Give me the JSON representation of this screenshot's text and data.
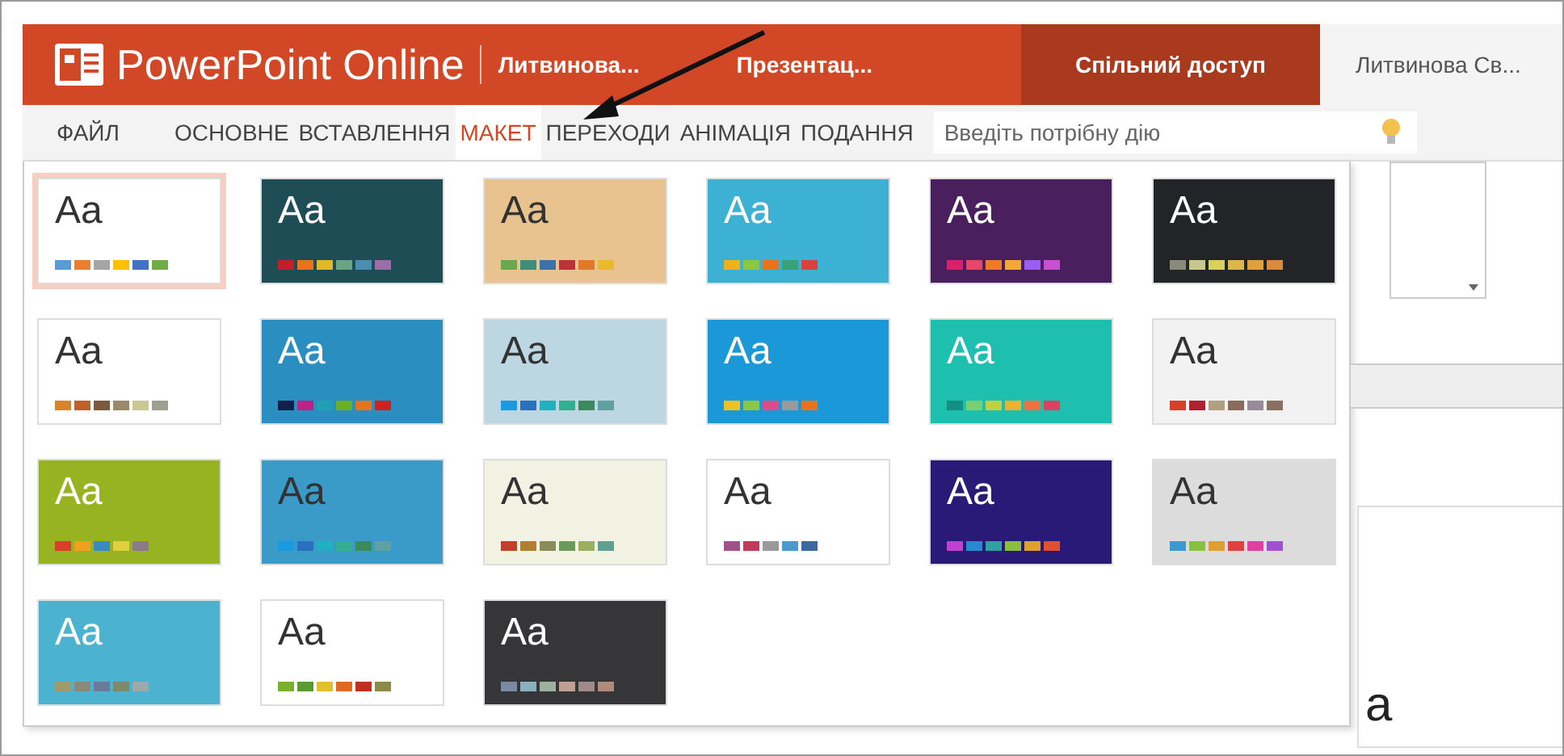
{
  "title_bar": {
    "app_name": "PowerPoint Online",
    "owner": "Литвинова...",
    "document": "Презентац...",
    "share_button": "Спільний доступ",
    "user": "Литвинова Св..."
  },
  "tabs": [
    {
      "label": "ФАЙЛ",
      "selected": false
    },
    {
      "label": "ОСНОВНЕ",
      "selected": false
    },
    {
      "label": "ВСТАВЛЕННЯ",
      "selected": false
    },
    {
      "label": "МАКЕТ",
      "selected": true
    },
    {
      "label": "ПЕРЕХОДИ",
      "selected": false
    },
    {
      "label": "АНІМАЦІЯ",
      "selected": false
    },
    {
      "label": "ПОДАННЯ",
      "selected": false
    }
  ],
  "tell_me": {
    "placeholder": "Введіть потрібну дію"
  },
  "themes": [
    {
      "sample": "Aa",
      "kind": "light",
      "color": "#ffffff",
      "selected": true,
      "swatches": [
        {
          "color": "#5b9bd5"
        },
        {
          "color": "#ed7d31"
        },
        {
          "color": "#a5a5a5"
        },
        {
          "color": "#ffc000"
        },
        {
          "color": "#4472c4"
        },
        {
          "color": "#70ad47"
        }
      ]
    },
    {
      "sample": "Aa",
      "kind": "dark",
      "color": "#1e4d56",
      "selected": false,
      "swatches": [
        {
          "color": "#c0202a"
        },
        {
          "color": "#e8731a"
        },
        {
          "color": "#e0b82a"
        },
        {
          "color": "#6aa583"
        },
        {
          "color": "#4b8db0"
        },
        {
          "color": "#9b6eaa"
        }
      ]
    },
    {
      "sample": "Aa",
      "kind": "light",
      "color": "#e8c38f",
      "selected": false,
      "swatches": [
        {
          "color": "#6aa84f"
        },
        {
          "color": "#3c8d7a"
        },
        {
          "color": "#3d6fa8"
        },
        {
          "color": "#b8333a"
        },
        {
          "color": "#e2782a"
        },
        {
          "color": "#e9b92e"
        }
      ]
    },
    {
      "sample": "Aa",
      "kind": "dark",
      "color": "#3cb1d4",
      "selected": false,
      "swatches": [
        {
          "color": "#f0b21a"
        },
        {
          "color": "#8dc63f"
        },
        {
          "color": "#e8731a"
        },
        {
          "color": "#3aa07a"
        },
        {
          "color": "#d9413a"
        }
      ]
    },
    {
      "sample": "Aa",
      "kind": "dark",
      "color": "#4a1f5e",
      "selected": false,
      "swatches": [
        {
          "color": "#d9206a"
        },
        {
          "color": "#e8456a"
        },
        {
          "color": "#ef7a2a"
        },
        {
          "color": "#f2a93a"
        },
        {
          "color": "#9a5ef0"
        },
        {
          "color": "#c84fd0"
        }
      ]
    },
    {
      "sample": "Aa",
      "kind": "dark",
      "color": "#222428",
      "selected": false,
      "swatches": [
        {
          "color": "#8a8a7a"
        },
        {
          "color": "#c7c78a"
        },
        {
          "color": "#d9d25a"
        },
        {
          "color": "#d9b84a"
        },
        {
          "color": "#e0a03a"
        },
        {
          "color": "#d98a3a"
        }
      ]
    },
    {
      "sample": "Aa",
      "kind": "light",
      "color": "#ffffff",
      "selected": false,
      "swatches": [
        {
          "color": "#d9822a"
        },
        {
          "color": "#c0602a"
        },
        {
          "color": "#7a5a3a"
        },
        {
          "color": "#9a8a6a"
        },
        {
          "color": "#c8c890"
        },
        {
          "color": "#a0a090"
        }
      ]
    },
    {
      "sample": "Aa",
      "kind": "dark",
      "color": "#2a8fc0",
      "selected": false,
      "swatches": [
        {
          "color": "#10204a"
        },
        {
          "color": "#c0208a"
        },
        {
          "color": "#20a0b0"
        },
        {
          "color": "#6ab020"
        },
        {
          "color": "#e8731a"
        },
        {
          "color": "#d02020"
        }
      ]
    },
    {
      "sample": "Aa",
      "kind": "light",
      "color": "#bcd6e2",
      "selected": false,
      "swatches": [
        {
          "color": "#1a9ae0"
        },
        {
          "color": "#2a70c0"
        },
        {
          "color": "#20b0c0"
        },
        {
          "color": "#30b090"
        },
        {
          "color": "#3a8a5a"
        },
        {
          "color": "#60a0a0"
        }
      ]
    },
    {
      "sample": "Aa",
      "kind": "dark",
      "color": "#1a98d8",
      "selected": false,
      "swatches": [
        {
          "color": "#f0c020"
        },
        {
          "color": "#8dc63f"
        },
        {
          "color": "#e04a8a"
        },
        {
          "color": "#9a9a9a"
        },
        {
          "color": "#e8731a"
        }
      ]
    },
    {
      "sample": "Aa",
      "kind": "dark",
      "color": "#1fbfb0",
      "selected": false,
      "swatches": [
        {
          "color": "#138f84"
        },
        {
          "color": "#7ad070"
        },
        {
          "color": "#c0d040"
        },
        {
          "color": "#f0b030"
        },
        {
          "color": "#f07040"
        },
        {
          "color": "#e04060"
        }
      ]
    },
    {
      "sample": "Aa",
      "kind": "light",
      "color": "#f2f2f2",
      "selected": false,
      "swatches": [
        {
          "color": "#d9402a"
        },
        {
          "color": "#b02030"
        },
        {
          "color": "#b0a080"
        },
        {
          "color": "#8a6a5a"
        },
        {
          "color": "#9a8a9a"
        },
        {
          "color": "#8a7060"
        }
      ]
    },
    {
      "sample": "Aa",
      "kind": "dark",
      "color": "#98b322",
      "selected": false,
      "swatches": [
        {
          "color": "#d9402a"
        },
        {
          "color": "#f0a020"
        },
        {
          "color": "#3a8ac0"
        },
        {
          "color": "#e0d040"
        },
        {
          "color": "#8a7a8a"
        }
      ]
    },
    {
      "sample": "Aa",
      "kind": "light",
      "color": "#3a9ac8",
      "selected": false,
      "swatches": [
        {
          "color": "#1a9ae0"
        },
        {
          "color": "#2a70c0"
        },
        {
          "color": "#20b0c0"
        },
        {
          "color": "#30b090"
        },
        {
          "color": "#3a8a5a"
        },
        {
          "color": "#60a0a0"
        }
      ]
    },
    {
      "sample": "Aa",
      "kind": "light",
      "color": "#f1f2e2",
      "selected": false,
      "swatches": [
        {
          "color": "#c0402a"
        },
        {
          "color": "#b08030"
        },
        {
          "color": "#8a8a5a"
        },
        {
          "color": "#6a9a5a"
        },
        {
          "color": "#9ab060"
        },
        {
          "color": "#60a090"
        }
      ]
    },
    {
      "sample": "Aa",
      "kind": "light",
      "color": "#ffffff",
      "selected": false,
      "swatches": [
        {
          "color": "#a0508a"
        },
        {
          "color": "#c03a5a"
        },
        {
          "color": "#9a9a9a"
        },
        {
          "color": "#4a9ad0"
        },
        {
          "color": "#3a6aa0"
        }
      ]
    },
    {
      "sample": "Aa",
      "kind": "dark",
      "color": "#2a1a78",
      "selected": false,
      "swatches": [
        {
          "color": "#c040d0"
        },
        {
          "color": "#2a8ad0"
        },
        {
          "color": "#30a0a0"
        },
        {
          "color": "#8ac040"
        },
        {
          "color": "#e0a030"
        },
        {
          "color": "#e05030"
        }
      ]
    },
    {
      "sample": "Aa",
      "kind": "light",
      "color": "#dcdcdc",
      "selected": false,
      "swatches": [
        {
          "color": "#3a9ad0"
        },
        {
          "color": "#8ac040"
        },
        {
          "color": "#e0a030"
        },
        {
          "color": "#e04040"
        },
        {
          "color": "#e040a0"
        },
        {
          "color": "#a050d0"
        }
      ]
    },
    {
      "sample": "Aa",
      "kind": "dark",
      "color": "#4bb3cf",
      "selected": false,
      "swatches": [
        {
          "color": "#a09a6a"
        },
        {
          "color": "#8a8a7a"
        },
        {
          "color": "#6a7a9a"
        },
        {
          "color": "#7a8a6a"
        },
        {
          "color": "#9aaaaa"
        }
      ]
    },
    {
      "sample": "Aa",
      "kind": "light",
      "color": "#ffffff",
      "selected": false,
      "swatches": [
        {
          "color": "#7ab030"
        },
        {
          "color": "#5a9a30"
        },
        {
          "color": "#e0c030"
        },
        {
          "color": "#e06a20"
        },
        {
          "color": "#c03020"
        },
        {
          "color": "#8a8a4a"
        }
      ]
    },
    {
      "sample": "Aa",
      "kind": "dark",
      "color": "#363638",
      "selected": false,
      "swatches": [
        {
          "color": "#7a8aa0"
        },
        {
          "color": "#8ab0c0"
        },
        {
          "color": "#a0b0a0"
        },
        {
          "color": "#c0a090"
        },
        {
          "color": "#a08a8a"
        },
        {
          "color": "#b08a7a"
        }
      ]
    }
  ],
  "slide_fragment": "a"
}
